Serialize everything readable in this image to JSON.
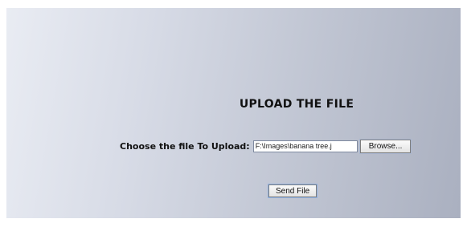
{
  "page": {
    "title": "UPLOAD THE FILE"
  },
  "upload": {
    "label": "Choose the file To Upload:",
    "file_path_value": "F:\\Images\\banana tree.j",
    "browse_label": "Browse..."
  },
  "actions": {
    "send_label": "Send File"
  }
}
